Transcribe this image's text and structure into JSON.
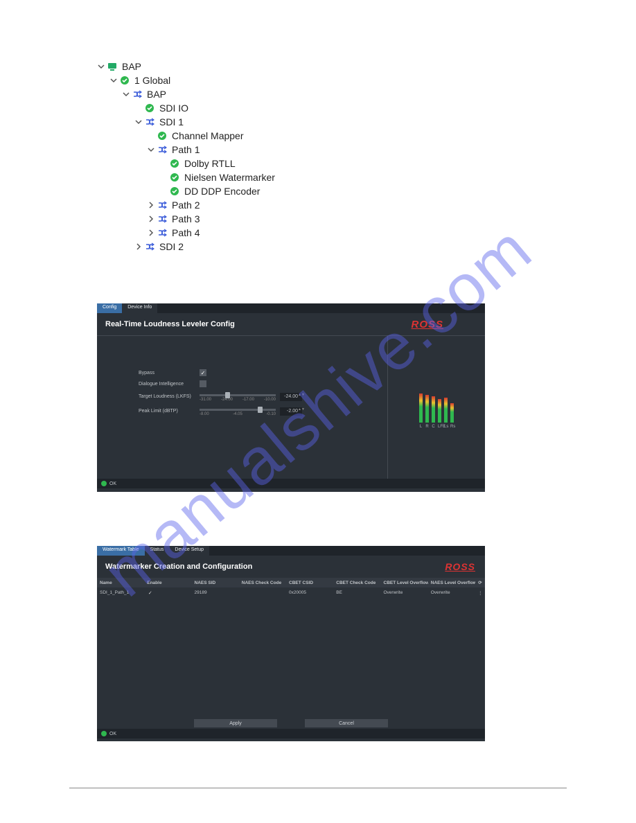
{
  "watermark": "manualshive.com",
  "tree": [
    {
      "depth": 0,
      "caret": "down",
      "icon": "device",
      "label": "BAP"
    },
    {
      "depth": 1,
      "caret": "down",
      "icon": "status",
      "label": "1 Global"
    },
    {
      "depth": 2,
      "caret": "down",
      "icon": "route",
      "label": "BAP"
    },
    {
      "depth": 3,
      "caret": "",
      "icon": "status",
      "label": "SDI IO"
    },
    {
      "depth": 3,
      "caret": "down",
      "icon": "route",
      "label": "SDI 1"
    },
    {
      "depth": 4,
      "caret": "",
      "icon": "status",
      "label": "Channel Mapper"
    },
    {
      "depth": 4,
      "caret": "down",
      "icon": "route",
      "label": "Path 1"
    },
    {
      "depth": 5,
      "caret": "",
      "icon": "status",
      "label": "Dolby RTLL"
    },
    {
      "depth": 5,
      "caret": "",
      "icon": "status",
      "label": "Nielsen Watermarker"
    },
    {
      "depth": 5,
      "caret": "",
      "icon": "status",
      "label": "DD DDP Encoder"
    },
    {
      "depth": 4,
      "caret": "right",
      "icon": "route",
      "label": "Path 2"
    },
    {
      "depth": 4,
      "caret": "right",
      "icon": "route",
      "label": "Path 3"
    },
    {
      "depth": 4,
      "caret": "right",
      "icon": "route",
      "label": "Path 4"
    },
    {
      "depth": 3,
      "caret": "right",
      "icon": "route",
      "label": "SDI 2"
    }
  ],
  "panel1": {
    "tabs": [
      "Config",
      "Device Info"
    ],
    "active_tab": 0,
    "title": "Real-Time Loudness Leveler Config",
    "logo": "ROSS",
    "controls": {
      "bypass_label": "Bypass",
      "bypass_checked": true,
      "dialogue_label": "Dialogue Intelligence",
      "dialogue_checked": false,
      "target_label": "Target Loudness (LKFS)",
      "target_ticks": [
        "-31.00",
        "-24.00",
        "-17.00",
        "-10.00"
      ],
      "target_value": "-24.00",
      "target_knob_pct": 34,
      "peak_label": "Peak Limit (dBTP)",
      "peak_ticks": [
        "-8.00",
        "-4.05",
        "-0.10"
      ],
      "peak_value": "-2.00",
      "peak_knob_pct": 76
    },
    "meters": {
      "heights": [
        42,
        40,
        38,
        34,
        36,
        28
      ],
      "labels": [
        "L",
        "R",
        "C",
        "LFE",
        "Ls",
        "Rs"
      ]
    },
    "status": "OK"
  },
  "panel2": {
    "tabs": [
      "Watermark Table",
      "Status",
      "Device Setup"
    ],
    "active_tab": 0,
    "title": "Watermarker Creation and Configuration",
    "logo": "ROSS",
    "columns": [
      "Name",
      "Enable",
      "NAES SID",
      "NAES Check Code",
      "CBET CSID",
      "CBET Check Code",
      "CBET Level Overflow",
      "NAES Level Overflow"
    ],
    "rows": [
      {
        "name": "SDI_1_Path_1",
        "enable": true,
        "naes_sid": "29189",
        "naes_check": "",
        "cbet_csid": "0x20005",
        "cbet_check": "BE",
        "cbet_overflow": "Overwrite",
        "naes_overflow": "Overwrite"
      }
    ],
    "buttons": {
      "apply": "Apply",
      "cancel": "Cancel"
    },
    "status": "OK"
  }
}
